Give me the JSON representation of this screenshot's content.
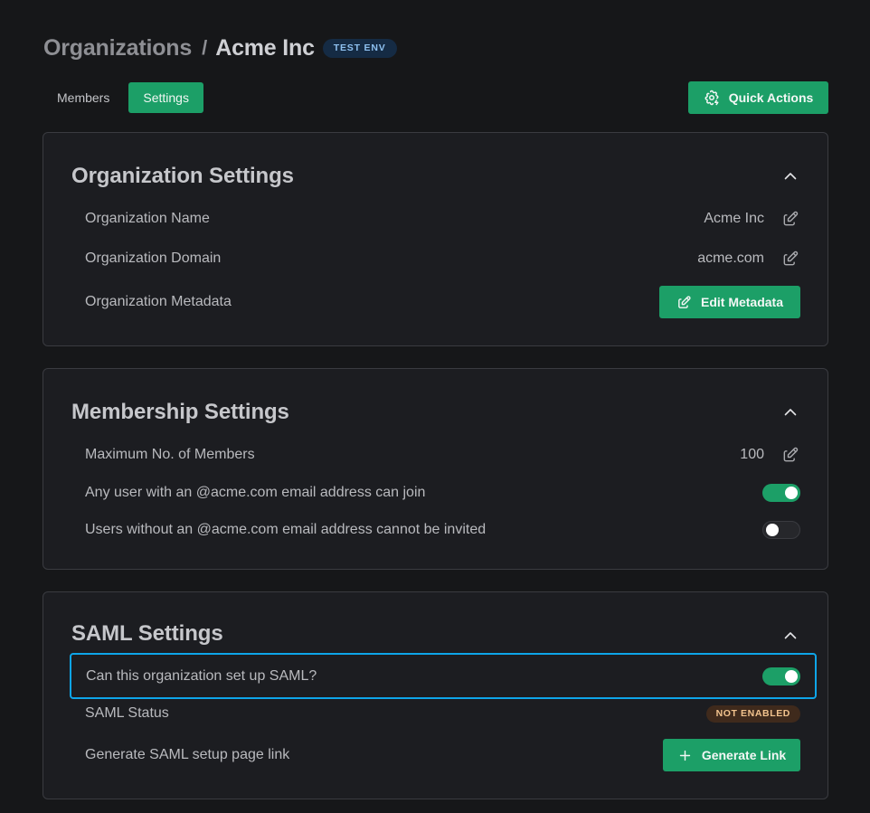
{
  "breadcrumb": {
    "root": "Organizations",
    "separator": "/",
    "current": "Acme Inc",
    "env_badge": "TEST ENV"
  },
  "tabs": [
    {
      "label": "Members",
      "active": false
    },
    {
      "label": "Settings",
      "active": true
    }
  ],
  "quick_actions": {
    "label": "Quick Actions",
    "icon": "gear-bolt-icon"
  },
  "organization_settings": {
    "title": "Organization Settings",
    "collapse_icon": "chevron-up-icon",
    "rows": {
      "name": {
        "label": "Organization Name",
        "value": "Acme Inc",
        "icon": "edit-icon"
      },
      "domain": {
        "label": "Organization Domain",
        "value": "acme.com",
        "icon": "edit-icon"
      },
      "metadata": {
        "label": "Organization Metadata",
        "button_label": "Edit Metadata",
        "icon": "edit-icon"
      }
    }
  },
  "membership_settings": {
    "title": "Membership Settings",
    "collapse_icon": "chevron-up-icon",
    "rows": {
      "max_members": {
        "label": "Maximum No. of Members",
        "value": "100",
        "icon": "edit-icon"
      },
      "domain_join": {
        "label": "Any user with an @acme.com email address can join",
        "enabled": true
      },
      "restrict_invites": {
        "label": "Users without an @acme.com email address cannot be invited",
        "enabled": false
      }
    }
  },
  "saml_settings": {
    "title": "SAML Settings",
    "collapse_icon": "chevron-up-icon",
    "rows": {
      "can_setup": {
        "label": "Can this organization set up SAML?",
        "enabled": true
      },
      "status": {
        "label": "SAML Status",
        "badge": "NOT ENABLED"
      },
      "setup_link": {
        "label": "Generate SAML setup page link",
        "button_label": "Generate Link",
        "icon": "plus-icon"
      }
    }
  },
  "colors": {
    "background": "#161719",
    "card": "#1c1d21",
    "accent_green": "#1c9f67",
    "focus_ring": "#0ea5e9",
    "env_badge_bg": "#152b44",
    "env_badge_text": "#8ec0ef",
    "status_badge_bg": "#3f2a1c",
    "status_badge_text": "#f2c38e"
  }
}
